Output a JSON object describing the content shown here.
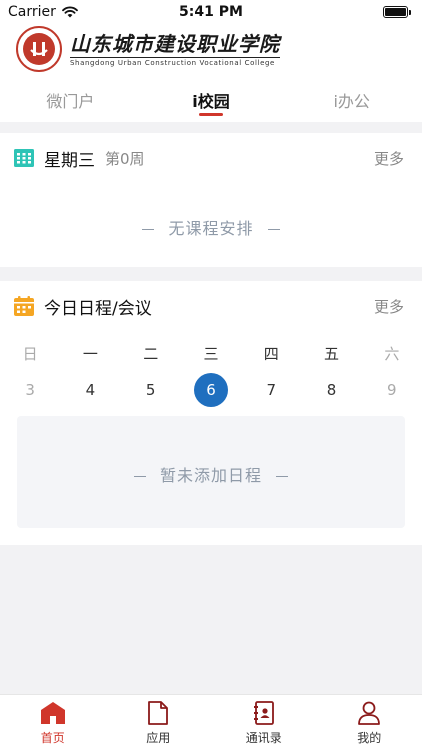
{
  "status_bar": {
    "carrier": "Carrier",
    "time": "5:41 PM"
  },
  "header": {
    "school_name_cn": "山东城市建设职业学院",
    "school_name_en": "Shangdong Urban Construction Vocational College",
    "tabs": [
      {
        "label": "微门户",
        "active": false
      },
      {
        "label": "i校园",
        "active": true
      },
      {
        "label": "i办公",
        "active": false
      }
    ]
  },
  "timetable_card": {
    "icon": "calendar-grid-icon",
    "title": "星期三",
    "week_label": "第0周",
    "more": "更多",
    "empty_text": "无课程安排"
  },
  "schedule_card": {
    "icon": "calendar-icon",
    "title": "今日日程/会议",
    "more": "更多",
    "weekdays": [
      "日",
      "一",
      "二",
      "三",
      "四",
      "五",
      "六"
    ],
    "dates": [
      "3",
      "4",
      "5",
      "6",
      "7",
      "8",
      "9"
    ],
    "selected_index": 3,
    "empty_text": "暂未添加日程"
  },
  "bottom_nav": {
    "items": [
      {
        "label": "首页",
        "icon": "home-icon",
        "active": true
      },
      {
        "label": "应用",
        "icon": "document-icon",
        "active": false
      },
      {
        "label": "通讯录",
        "icon": "contacts-icon",
        "active": false
      },
      {
        "label": "我的",
        "icon": "person-icon",
        "active": false
      }
    ]
  },
  "colors": {
    "accent": "#d0362b",
    "selected_date": "#1f6fbf",
    "timetable_icon": "#2ec4b6",
    "schedule_icon": "#f5a623",
    "nav_icon": "#8b1a1a"
  }
}
